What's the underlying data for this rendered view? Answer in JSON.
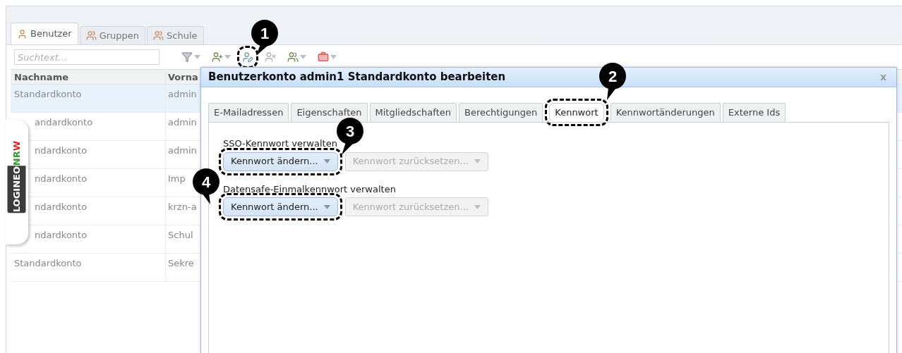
{
  "main_tabs": [
    {
      "label": "Benutzer",
      "selected": true
    },
    {
      "label": "Gruppen",
      "selected": false
    },
    {
      "label": "Schule",
      "selected": false
    }
  ],
  "toolbar": {
    "search": {
      "placeholder": "Suchtext..."
    },
    "tools": [
      {
        "kind": "filter",
        "dropdown": true,
        "highlighted": false
      },
      {
        "kind": "add-user",
        "dropdown": true,
        "highlighted": false
      },
      {
        "kind": "edit-user",
        "dropdown": false,
        "highlighted": true
      },
      {
        "kind": "remove-user",
        "dropdown": false,
        "highlighted": false
      },
      {
        "kind": "add-group",
        "dropdown": true,
        "highlighted": false
      },
      {
        "kind": "toolbox",
        "dropdown": true,
        "highlighted": false
      }
    ]
  },
  "table": {
    "columns": [
      "Nachname",
      "Vorna"
    ],
    "rows": [
      {
        "cells": [
          "Standardkonto",
          "admin"
        ],
        "selected": true,
        "covered": false
      },
      {
        "cells": [
          "andardkonto",
          "admin"
        ],
        "selected": false,
        "covered": true
      },
      {
        "cells": [
          "ndardkonto",
          "admin"
        ],
        "selected": false,
        "covered": true
      },
      {
        "cells": [
          "ndardkonto",
          "Imp"
        ],
        "selected": false,
        "covered": true
      },
      {
        "cells": [
          "ndardkonto",
          "krzn-a"
        ],
        "selected": false,
        "covered": true
      },
      {
        "cells": [
          "ndardkonto",
          "Schul"
        ],
        "selected": false,
        "covered": true
      },
      {
        "cells": [
          "Standardkonto",
          "Sekre"
        ],
        "selected": false,
        "covered": false
      }
    ]
  },
  "logo": {
    "dark_part": "LOGINEO",
    "light_part": "NRW"
  },
  "dialog": {
    "title": "Benutzerkonto admin1 Standardkonto bearbeiten",
    "close": "x",
    "tabs": [
      {
        "label": "E-Mailadressen",
        "selected": false,
        "highlighted": false
      },
      {
        "label": "Eigenschaften",
        "selected": false,
        "highlighted": false
      },
      {
        "label": "Mitgliedschaften",
        "selected": false,
        "highlighted": false
      },
      {
        "label": "Berechtigungen",
        "selected": false,
        "highlighted": false
      },
      {
        "label": "Kennwort",
        "selected": true,
        "highlighted": true
      },
      {
        "label": "Kennwortänderungen",
        "selected": false,
        "highlighted": false
      },
      {
        "label": "Externe Ids",
        "selected": false,
        "highlighted": false
      }
    ],
    "sections": [
      {
        "label": "SSO-Kennwort verwalten",
        "buttons": [
          {
            "label": "Kennwort ändern...",
            "disabled": false,
            "highlighted": true
          },
          {
            "label": "Kennwort zurücksetzen...",
            "disabled": true,
            "highlighted": false
          }
        ]
      },
      {
        "label": "Datensafe-Einmalkennwort verwalten",
        "buttons": [
          {
            "label": "Kennwort ändern...",
            "disabled": false,
            "highlighted": true
          },
          {
            "label": "Kennwort zurücksetzen...",
            "disabled": true,
            "highlighted": false
          }
        ]
      }
    ]
  },
  "annotations": [
    {
      "label": "1"
    },
    {
      "label": "2"
    },
    {
      "label": "3"
    },
    {
      "label": "4"
    }
  ]
}
